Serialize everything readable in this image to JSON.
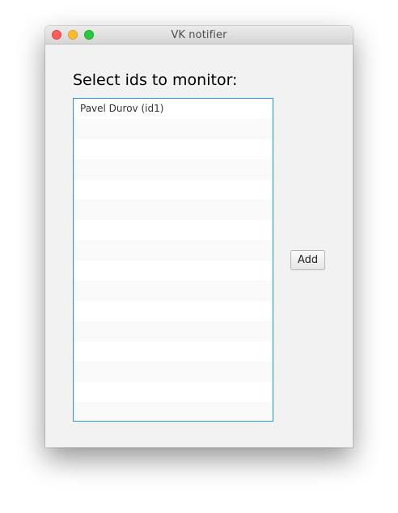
{
  "window": {
    "title": "VK notifier"
  },
  "main": {
    "heading": "Select ids to monitor:",
    "list": {
      "items": [
        "Pavel Durov (id1)"
      ],
      "visible_row_count": 16
    },
    "add_button_label": "Add"
  },
  "colors": {
    "window_bg": "#f2f2f2",
    "list_focus_border": "#1f9bd6",
    "row_alt_bg": "#f9f9f9",
    "close_light": "#fc5f57",
    "minimize_light": "#fdbc2e",
    "zoom_light": "#28c840"
  }
}
